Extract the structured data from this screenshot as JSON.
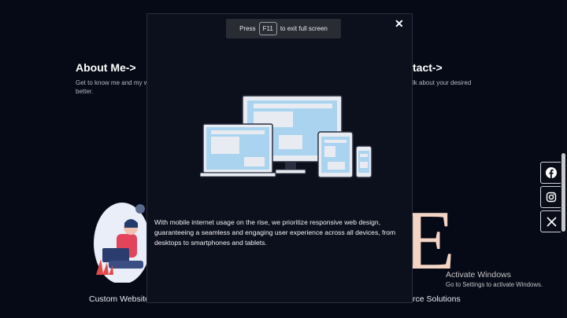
{
  "background": {
    "sections": [
      {
        "title": "About Me->",
        "text": "Get to know me and my wo",
        "text2": "better."
      },
      {
        "title": "tact->",
        "text": "lk about your desired"
      }
    ],
    "captions": [
      "Custom Website",
      "rce Solutions"
    ]
  },
  "fullscreen_notice": {
    "before": "Press",
    "key": "F11",
    "after": "to exit full screen"
  },
  "modal": {
    "close_icon": "close-icon",
    "text": "With mobile internet usage on the rise, we prioritize responsive web design, guaranteeing a seamless and engaging user experience across all devices, from desktops to smartphones and tablets."
  },
  "social": [
    "facebook-icon",
    "instagram-icon",
    "x-icon"
  ],
  "windows_activation": {
    "title": "Activate Windows",
    "subtitle": "Go to Settings to activate Windows."
  },
  "colors": {
    "background": "#060916",
    "modal": "#0c0f1c",
    "screen_fill": "#a9d3ee"
  }
}
